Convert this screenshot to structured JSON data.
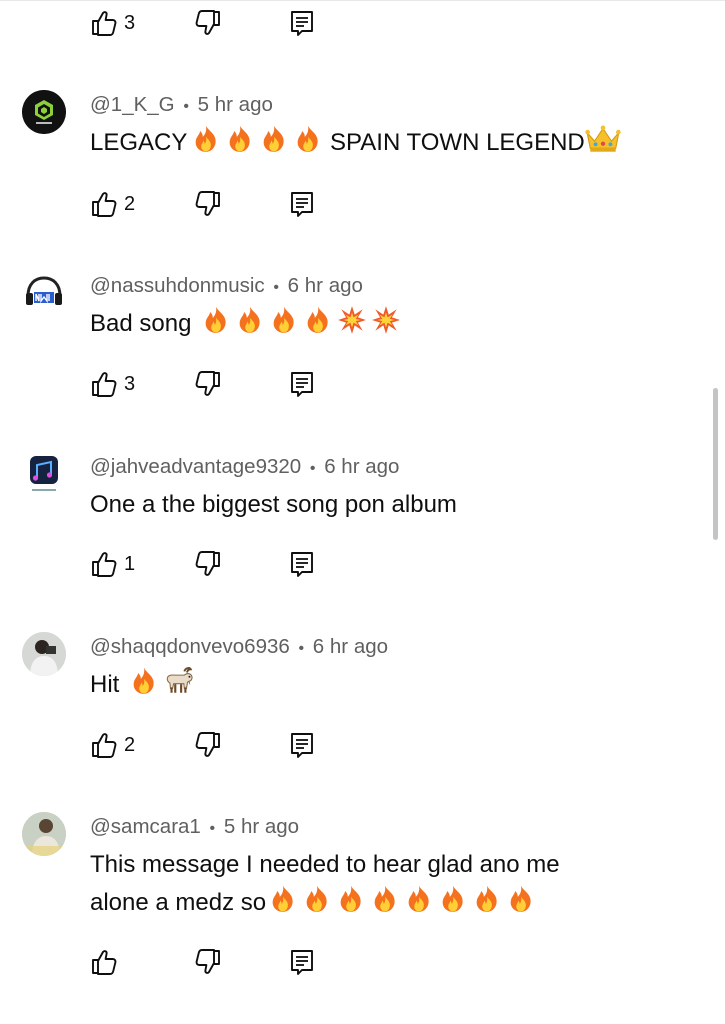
{
  "comments": [
    {
      "author": "@1_K_G",
      "time": "5 hr ago",
      "text_before": "LEGACY",
      "text_middle": " SPAIN TOWN LEGEND",
      "likes": "2"
    },
    {
      "author": "@nassuhdonmusic",
      "time": "6 hr ago",
      "text": "Bad song",
      "likes": "3"
    },
    {
      "author": "@jahveadvantage9320",
      "time": "6 hr ago",
      "text": "One a the biggest song pon album",
      "likes": "1"
    },
    {
      "author": "@shaqqdonvevo6936",
      "time": "6 hr ago",
      "text": "Hit",
      "likes": "2"
    },
    {
      "author": "@samcara1",
      "time": "5 hr ago",
      "text_line1": "This message I needed to hear glad ano me",
      "text_line2": "alone a medz so",
      "likes": ""
    }
  ],
  "top_row": {
    "likes": "3"
  },
  "meta_separator": "•",
  "icons": {
    "like": "thumbs-up-icon",
    "dislike": "thumbs-down-icon",
    "reply": "reply-comment-icon",
    "fire": "fire-emoji",
    "crown": "crown-emoji",
    "collision": "collision-emoji",
    "goat": "goat-emoji"
  },
  "colors": {
    "text": "#0f0f0f",
    "meta": "#606060",
    "background": "#ffffff"
  }
}
